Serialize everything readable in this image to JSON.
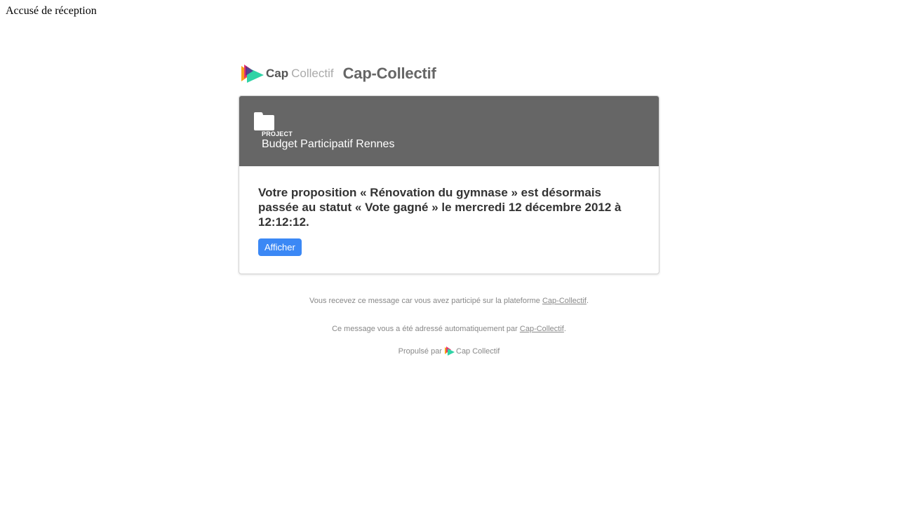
{
  "document": {
    "title": "Accusé de réception"
  },
  "brand": {
    "logo_bold": "Cap",
    "logo_light": "Collectif",
    "name": "Cap-Collectif"
  },
  "card": {
    "header": {
      "icon": "folder-icon",
      "label": "PROJECT",
      "project": "Budget Participatif Rennes",
      "background": "#666666"
    },
    "message": "Votre proposition « Rénovation du gymnase » est désormais passée au statut « Vote gagné » le mercredi 12 décembre 2012 à 12:12:12.",
    "button_label": "Afficher",
    "button_color": "#3b88f5"
  },
  "footer": {
    "line1_prefix": "Vous recevez ce message car vous avez participé sur la plateforme ",
    "line1_link": "Cap-Collectif",
    "line1_suffix": ".",
    "line2_prefix": "Ce message vous a été adressé automatiquement par ",
    "line2_link": "Cap-Collectif",
    "line2_suffix": ".",
    "powered_prefix": "Propulsé par",
    "powered_name": "Cap Collectif"
  }
}
